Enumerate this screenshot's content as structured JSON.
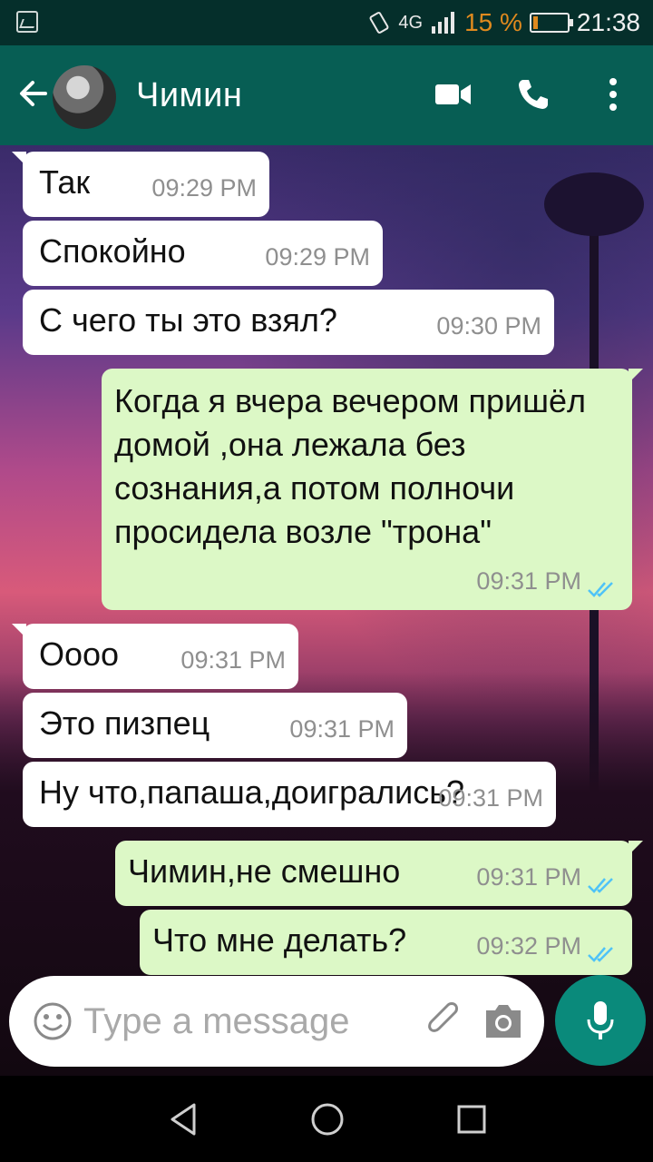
{
  "status_bar": {
    "network": "4G",
    "battery_percent": "15 %",
    "battery_level": 0.15,
    "time": "21:38",
    "battery_color": "#e08a1e"
  },
  "header": {
    "contact_name": "Чимин",
    "color": "#075e54",
    "icons": [
      "back-arrow-icon",
      "avatar",
      "video-call-icon",
      "phone-icon",
      "more-vert-icon"
    ]
  },
  "messages": [
    {
      "dir": "in",
      "text": "Так",
      "time": "09:29 PM"
    },
    {
      "dir": "in",
      "text": "Спокойно",
      "time": "09:29 PM"
    },
    {
      "dir": "in",
      "text": "С чего ты это взял?",
      "time": "09:30 PM"
    },
    {
      "dir": "out",
      "text": "Когда я вчера вечером пришёл домой ,она лежала без сознания,а потом полночи просидела возле \"трона\"",
      "time": "09:31 PM",
      "read": true
    },
    {
      "dir": "in",
      "text": "Оооо",
      "time": "09:31 PM"
    },
    {
      "dir": "in",
      "text": "Это пизпец",
      "time": "09:31 PM"
    },
    {
      "dir": "in",
      "text": "Ну что,папаша,доигрались?",
      "time": "09:31 PM"
    },
    {
      "dir": "out",
      "text": "Чимин,не смешно",
      "time": "09:31 PM",
      "read": true
    },
    {
      "dir": "out",
      "text": "Что мне делать?",
      "time": "09:32 PM",
      "read": true
    }
  ],
  "input": {
    "placeholder": "Type a message",
    "icons": [
      "emoji-icon",
      "attach-icon",
      "camera-icon",
      "mic-icon"
    ]
  },
  "colors": {
    "incoming_bubble": "#ffffff",
    "outgoing_bubble": "#dcf8c6",
    "read_ticks": "#4fc3f7",
    "mic_button": "#0a8a7b"
  }
}
